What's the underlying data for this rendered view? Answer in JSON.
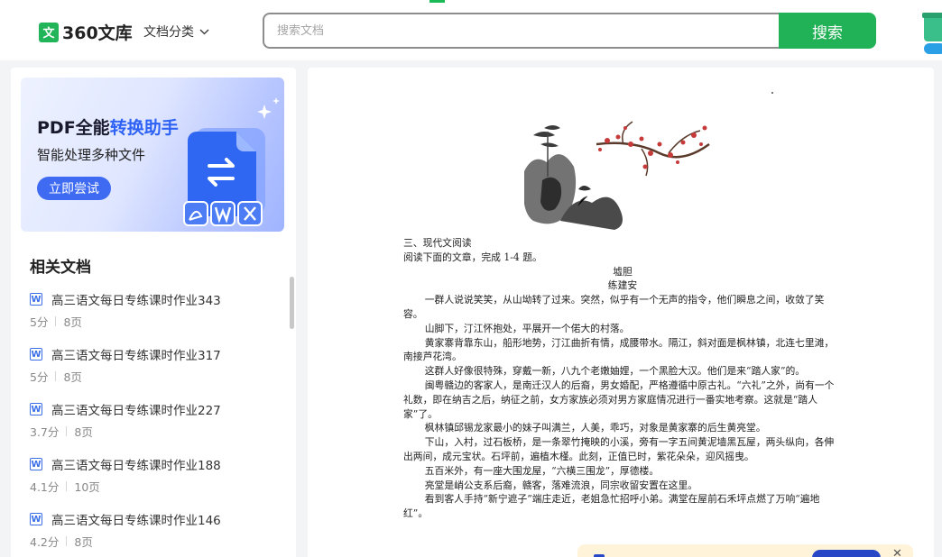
{
  "header": {
    "logo_badge": "文",
    "logo_text": "360文库",
    "category_label": "文档分类",
    "search_placeholder": "搜索文档",
    "search_button": "搜索"
  },
  "promo": {
    "title_prefix": "PDF全能",
    "title_highlight": "转换助手",
    "subtitle": "智能处理多种文件",
    "button": "立即尝试"
  },
  "related": {
    "title": "相关文档",
    "items": [
      {
        "name": "高三语文每日专练课时作业343",
        "score": "5分",
        "pages": "8页"
      },
      {
        "name": "高三语文每日专练课时作业317",
        "score": "5分",
        "pages": "8页"
      },
      {
        "name": "高三语文每日专练课时作业227",
        "score": "3.7分",
        "pages": "8页"
      },
      {
        "name": "高三语文每日专练课时作业188",
        "score": "4.1分",
        "pages": "10页"
      },
      {
        "name": "高三语文每日专练课时作业146",
        "score": "4.2分",
        "pages": "8页"
      }
    ]
  },
  "document": {
    "lines": [
      "三、现代文阅读",
      "阅读下面的文章，完成 1-4 题。",
      "墟胆",
      "练建安",
      "一群人说说笑笑，从山坳转了过来。突然，似乎有一个无声的指令，他们瞬息之间，收敛了笑容。",
      "山脚下，汀江怀抱处，平展开一个偌大的村落。",
      "黄家寨背靠东山，船形地势，汀江曲折有情，成腰带水。隔江，斜对面是枫林镇，北连七里滩，南接芦花湾。",
      "这群人好像很特殊，穿戴一新，八九个老嫩妯娌，一个黑脸大汉。他们是来“踏人家”的。",
      "闽粤赣边的客家人，是南迁汉人的后裔，男女婚配，严格遵循中原古礼。“六礼”之外，尚有一个礼数，即在纳吉之后，纳征之前，女方家族必须对男方家庭情况进行一番实地考察。这就是“踏人家”了。",
      "枫林镇邱锡龙家最小的妹子叫满兰，人美，乖巧，对象是黄家寨的后生黄亮堂。",
      "下山，入村，过石板桥，是一条翠竹掩映的小溪，旁有一字五间黄泥墙黑瓦屋，两头纵向，各伸出两间，成元宝状。石坪前，遍植木槿。此刻，正值已时，紫花朵朵，迎风摇曳。",
      "五百米外，有一座大围龙屋，“六横三围龙”，厚德楼。",
      "亮堂是峭公支系后裔，赣客，落难流浪，同宗收留安置在这里。",
      "看到客人手持“新宁遮子”端庄走近，老姐急忙招呼小弟。满堂在屋前石禾坪点燃了万响“遍地红”。"
    ]
  }
}
